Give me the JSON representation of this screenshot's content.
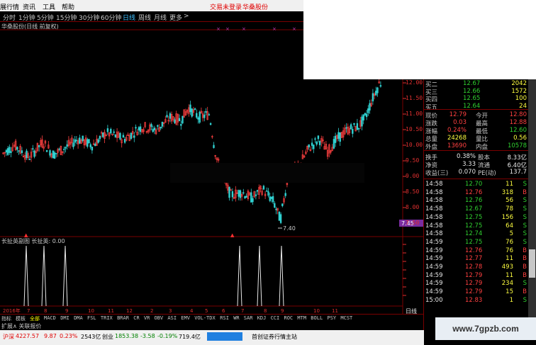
{
  "menu": {
    "items": [
      "展行情",
      "资讯",
      "工具",
      "帮助"
    ],
    "trade_status": "交易未登录",
    "stock_link": "华桑股份"
  },
  "periods": [
    "分时",
    "1分钟",
    "5分钟",
    "15分钟",
    "30分钟",
    "60分钟",
    "日线",
    "周线",
    "月线",
    "更多"
  ],
  "active_period": "日线",
  "chart_title": "华桑股份(日线 前复权)",
  "price_axis": [
    "12.00",
    "11.50",
    "11.00",
    "10.50",
    "10.00",
    "9.50",
    "9.00",
    "8.50",
    "8.00",
    "7.50"
  ],
  "current_price_tag": "7.45",
  "low_marker": "7.40",
  "indicator_title": "长扯英副图  长扯英: 0.00",
  "date_axis": [
    "2016年",
    "7",
    "8",
    "9",
    "10",
    "11",
    "12",
    "2",
    "3",
    "4",
    "5",
    "6",
    "7",
    "8",
    "9",
    "10",
    "11"
  ],
  "period_label": "日线",
  "indicator_tabs": [
    "指标",
    "模板",
    "全部",
    "MACD",
    "DMI",
    "DMA",
    "FSL",
    "TRIX",
    "BRAR",
    "CR",
    "VR",
    "OBV",
    "ASI",
    "EMV",
    "VOL-TDX",
    "RSI",
    "WR",
    "SAR",
    "KDJ",
    "CCI",
    "ROC",
    "MTM",
    "BOLL",
    "PSY",
    "MCST"
  ],
  "selected_tab": "全部",
  "expand_label": "扩展∧  关联报价",
  "quotes": {
    "bids": [
      {
        "label": "买二",
        "price": "12.67",
        "vol": "2042"
      },
      {
        "label": "买三",
        "price": "12.66",
        "vol": "1572"
      },
      {
        "label": "买四",
        "price": "12.65",
        "vol": "100"
      },
      {
        "label": "买五",
        "price": "12.64",
        "vol": "24"
      }
    ],
    "stats": [
      {
        "l1": "现价",
        "v1": "12.79",
        "c1": "red",
        "l2": "今开",
        "v2": "12.80",
        "c2": "red"
      },
      {
        "l1": "涨跌",
        "v1": "0.03",
        "c1": "red",
        "l2": "最高",
        "v2": "12.88",
        "c2": "red"
      },
      {
        "l1": "涨幅",
        "v1": "0.24%",
        "c1": "red",
        "l2": "最低",
        "v2": "12.60",
        "c2": "green"
      },
      {
        "l1": "总量",
        "v1": "24268",
        "c1": "yellow",
        "l2": "量比",
        "v2": "0.56",
        "c2": "yellow"
      },
      {
        "l1": "外盘",
        "v1": "13690",
        "c1": "red",
        "l2": "内盘",
        "v2": "10578",
        "c2": "green"
      }
    ],
    "fund": [
      {
        "l1": "换手",
        "v1": "0.38%",
        "l2": "股本",
        "v2": "8.33亿"
      },
      {
        "l1": "净资",
        "v1": "3.33",
        "l2": "流通",
        "v2": "6.40亿"
      },
      {
        "l1": "收益(三)",
        "v1": "0.070",
        "l2": "PE(动)",
        "v2": "137.7"
      }
    ],
    "ticks": [
      {
        "t": "14:58",
        "p": "12.70",
        "pc": "green",
        "v": "11",
        "s": "S"
      },
      {
        "t": "14:58",
        "p": "12.76",
        "pc": "red",
        "v": "318",
        "s": "B"
      },
      {
        "t": "14:58",
        "p": "12.76",
        "pc": "green",
        "v": "56",
        "s": "S"
      },
      {
        "t": "14:58",
        "p": "12.67",
        "pc": "green",
        "v": "78",
        "s": "S"
      },
      {
        "t": "14:58",
        "p": "12.75",
        "pc": "green",
        "v": "156",
        "s": "S"
      },
      {
        "t": "14:58",
        "p": "12.75",
        "pc": "green",
        "v": "64",
        "s": "S"
      },
      {
        "t": "14:58",
        "p": "12.74",
        "pc": "green",
        "v": "5",
        "s": "S"
      },
      {
        "t": "14:59",
        "p": "12.75",
        "pc": "green",
        "v": "76",
        "s": "S"
      },
      {
        "t": "14:59",
        "p": "12.76",
        "pc": "red",
        "v": "76",
        "s": "B"
      },
      {
        "t": "14:59",
        "p": "12.77",
        "pc": "red",
        "v": "11",
        "s": "B"
      },
      {
        "t": "14:59",
        "p": "12.78",
        "pc": "red",
        "v": "493",
        "s": "B"
      },
      {
        "t": "14:59",
        "p": "12.79",
        "pc": "red",
        "v": "11",
        "s": "B"
      },
      {
        "t": "14:59",
        "p": "12.79",
        "pc": "red",
        "v": "234",
        "s": "S"
      },
      {
        "t": "14:59",
        "p": "12.79",
        "pc": "red",
        "v": "15",
        "s": "B"
      },
      {
        "t": "15:00",
        "p": "12.83",
        "pc": "red",
        "v": "1",
        "s": "S"
      }
    ]
  },
  "status_bar": {
    "index1_name": "沪深",
    "index1_value": "4227.57",
    "index1_chg": "9.87",
    "index1_pct": "0.23%",
    "index1_amt": "2543亿",
    "index2_name": "创业",
    "index2_value": "1853.38",
    "index2_chg": "-3.58",
    "index2_pct": "-0.19%",
    "index2_amt": "719.4亿",
    "broker": "首创证券行情主站"
  },
  "watermark": "www.7gpzb.com",
  "colors": {
    "up": "#ff4040",
    "down": "#30d0d0",
    "accent_blue": "#3fc0ff",
    "frame": "#7a0000"
  }
}
